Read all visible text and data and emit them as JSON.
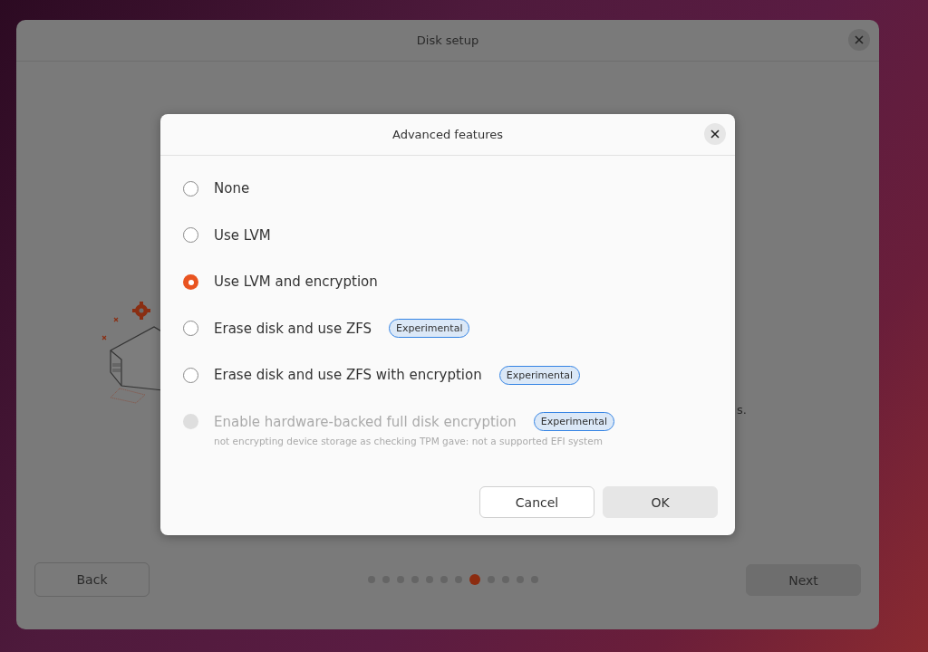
{
  "window": {
    "title": "Disk setup"
  },
  "background_text": "s.",
  "footer": {
    "back": "Back",
    "next": "Next",
    "steps": [
      {
        "selected": false
      },
      {
        "selected": false
      },
      {
        "selected": false
      },
      {
        "selected": false
      },
      {
        "selected": false
      },
      {
        "selected": false
      },
      {
        "selected": false
      },
      {
        "selected": true
      },
      {
        "selected": false
      },
      {
        "selected": false
      },
      {
        "selected": false
      },
      {
        "selected": false
      }
    ]
  },
  "dialog": {
    "title": "Advanced features",
    "options": [
      {
        "label": "None",
        "selected": false,
        "disabled": false
      },
      {
        "label": "Use LVM",
        "selected": false,
        "disabled": false
      },
      {
        "label": "Use LVM and encryption",
        "selected": true,
        "disabled": false
      },
      {
        "label": "Erase disk and use ZFS",
        "selected": false,
        "disabled": false,
        "badge": "Experimental"
      },
      {
        "label": "Erase disk and use ZFS with encryption",
        "selected": false,
        "disabled": false,
        "badge": "Experimental"
      },
      {
        "label": "Enable hardware-backed full disk encryption",
        "selected": false,
        "disabled": true,
        "badge": "Experimental",
        "note": "not encrypting device storage as checking TPM gave: not a supported EFI system"
      }
    ],
    "buttons": {
      "cancel": "Cancel",
      "ok": "OK"
    }
  }
}
